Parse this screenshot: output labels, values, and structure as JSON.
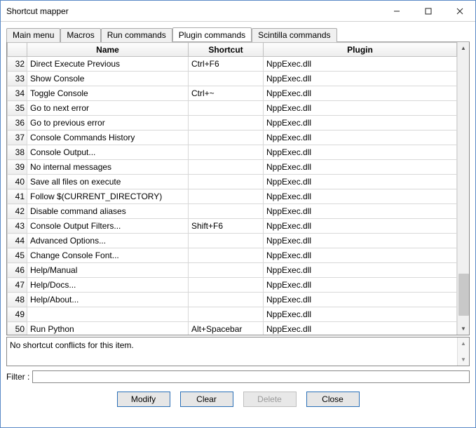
{
  "window": {
    "title": "Shortcut mapper"
  },
  "tabs": [
    {
      "label": "Main menu"
    },
    {
      "label": "Macros"
    },
    {
      "label": "Run commands"
    },
    {
      "label": "Plugin commands"
    },
    {
      "label": "Scintilla commands"
    }
  ],
  "active_tab": 3,
  "columns": {
    "index": "",
    "name": "Name",
    "shortcut": "Shortcut",
    "plugin": "Plugin"
  },
  "rows": [
    {
      "idx": "32",
      "name": "Direct Execute Previous",
      "shortcut": "Ctrl+F6",
      "plugin": "NppExec.dll"
    },
    {
      "idx": "33",
      "name": "Show Console",
      "shortcut": "",
      "plugin": "NppExec.dll"
    },
    {
      "idx": "34",
      "name": "Toggle Console",
      "shortcut": "Ctrl+~",
      "plugin": "NppExec.dll"
    },
    {
      "idx": "35",
      "name": "Go to next error",
      "shortcut": "",
      "plugin": "NppExec.dll"
    },
    {
      "idx": "36",
      "name": "Go to previous error",
      "shortcut": "",
      "plugin": "NppExec.dll"
    },
    {
      "idx": "37",
      "name": "Console Commands History",
      "shortcut": "",
      "plugin": "NppExec.dll"
    },
    {
      "idx": "38",
      "name": "Console Output...",
      "shortcut": "",
      "plugin": "NppExec.dll"
    },
    {
      "idx": "39",
      "name": "No internal messages",
      "shortcut": "",
      "plugin": "NppExec.dll"
    },
    {
      "idx": "40",
      "name": "Save all files on execute",
      "shortcut": "",
      "plugin": "NppExec.dll"
    },
    {
      "idx": "41",
      "name": "Follow $(CURRENT_DIRECTORY)",
      "shortcut": "",
      "plugin": "NppExec.dll"
    },
    {
      "idx": "42",
      "name": "Disable command aliases",
      "shortcut": "",
      "plugin": "NppExec.dll"
    },
    {
      "idx": "43",
      "name": "Console Output Filters...",
      "shortcut": "Shift+F6",
      "plugin": "NppExec.dll"
    },
    {
      "idx": "44",
      "name": "Advanced Options...",
      "shortcut": "",
      "plugin": "NppExec.dll"
    },
    {
      "idx": "45",
      "name": "Change Console Font...",
      "shortcut": "",
      "plugin": "NppExec.dll"
    },
    {
      "idx": "46",
      "name": "Help/Manual",
      "shortcut": "",
      "plugin": "NppExec.dll"
    },
    {
      "idx": "47",
      "name": "Help/Docs...",
      "shortcut": "",
      "plugin": "NppExec.dll"
    },
    {
      "idx": "48",
      "name": "Help/About...",
      "shortcut": "",
      "plugin": "NppExec.dll"
    },
    {
      "idx": "49",
      "name": "",
      "shortcut": "",
      "plugin": "NppExec.dll"
    },
    {
      "idx": "50",
      "name": "Run Python",
      "shortcut": "Alt+Spacebar",
      "plugin": "NppExec.dll"
    }
  ],
  "status": "No shortcut conflicts for this item.",
  "filter": {
    "label": "Filter :",
    "value": ""
  },
  "buttons": {
    "modify": "Modify",
    "clear": "Clear",
    "delete": "Delete",
    "close": "Close"
  }
}
